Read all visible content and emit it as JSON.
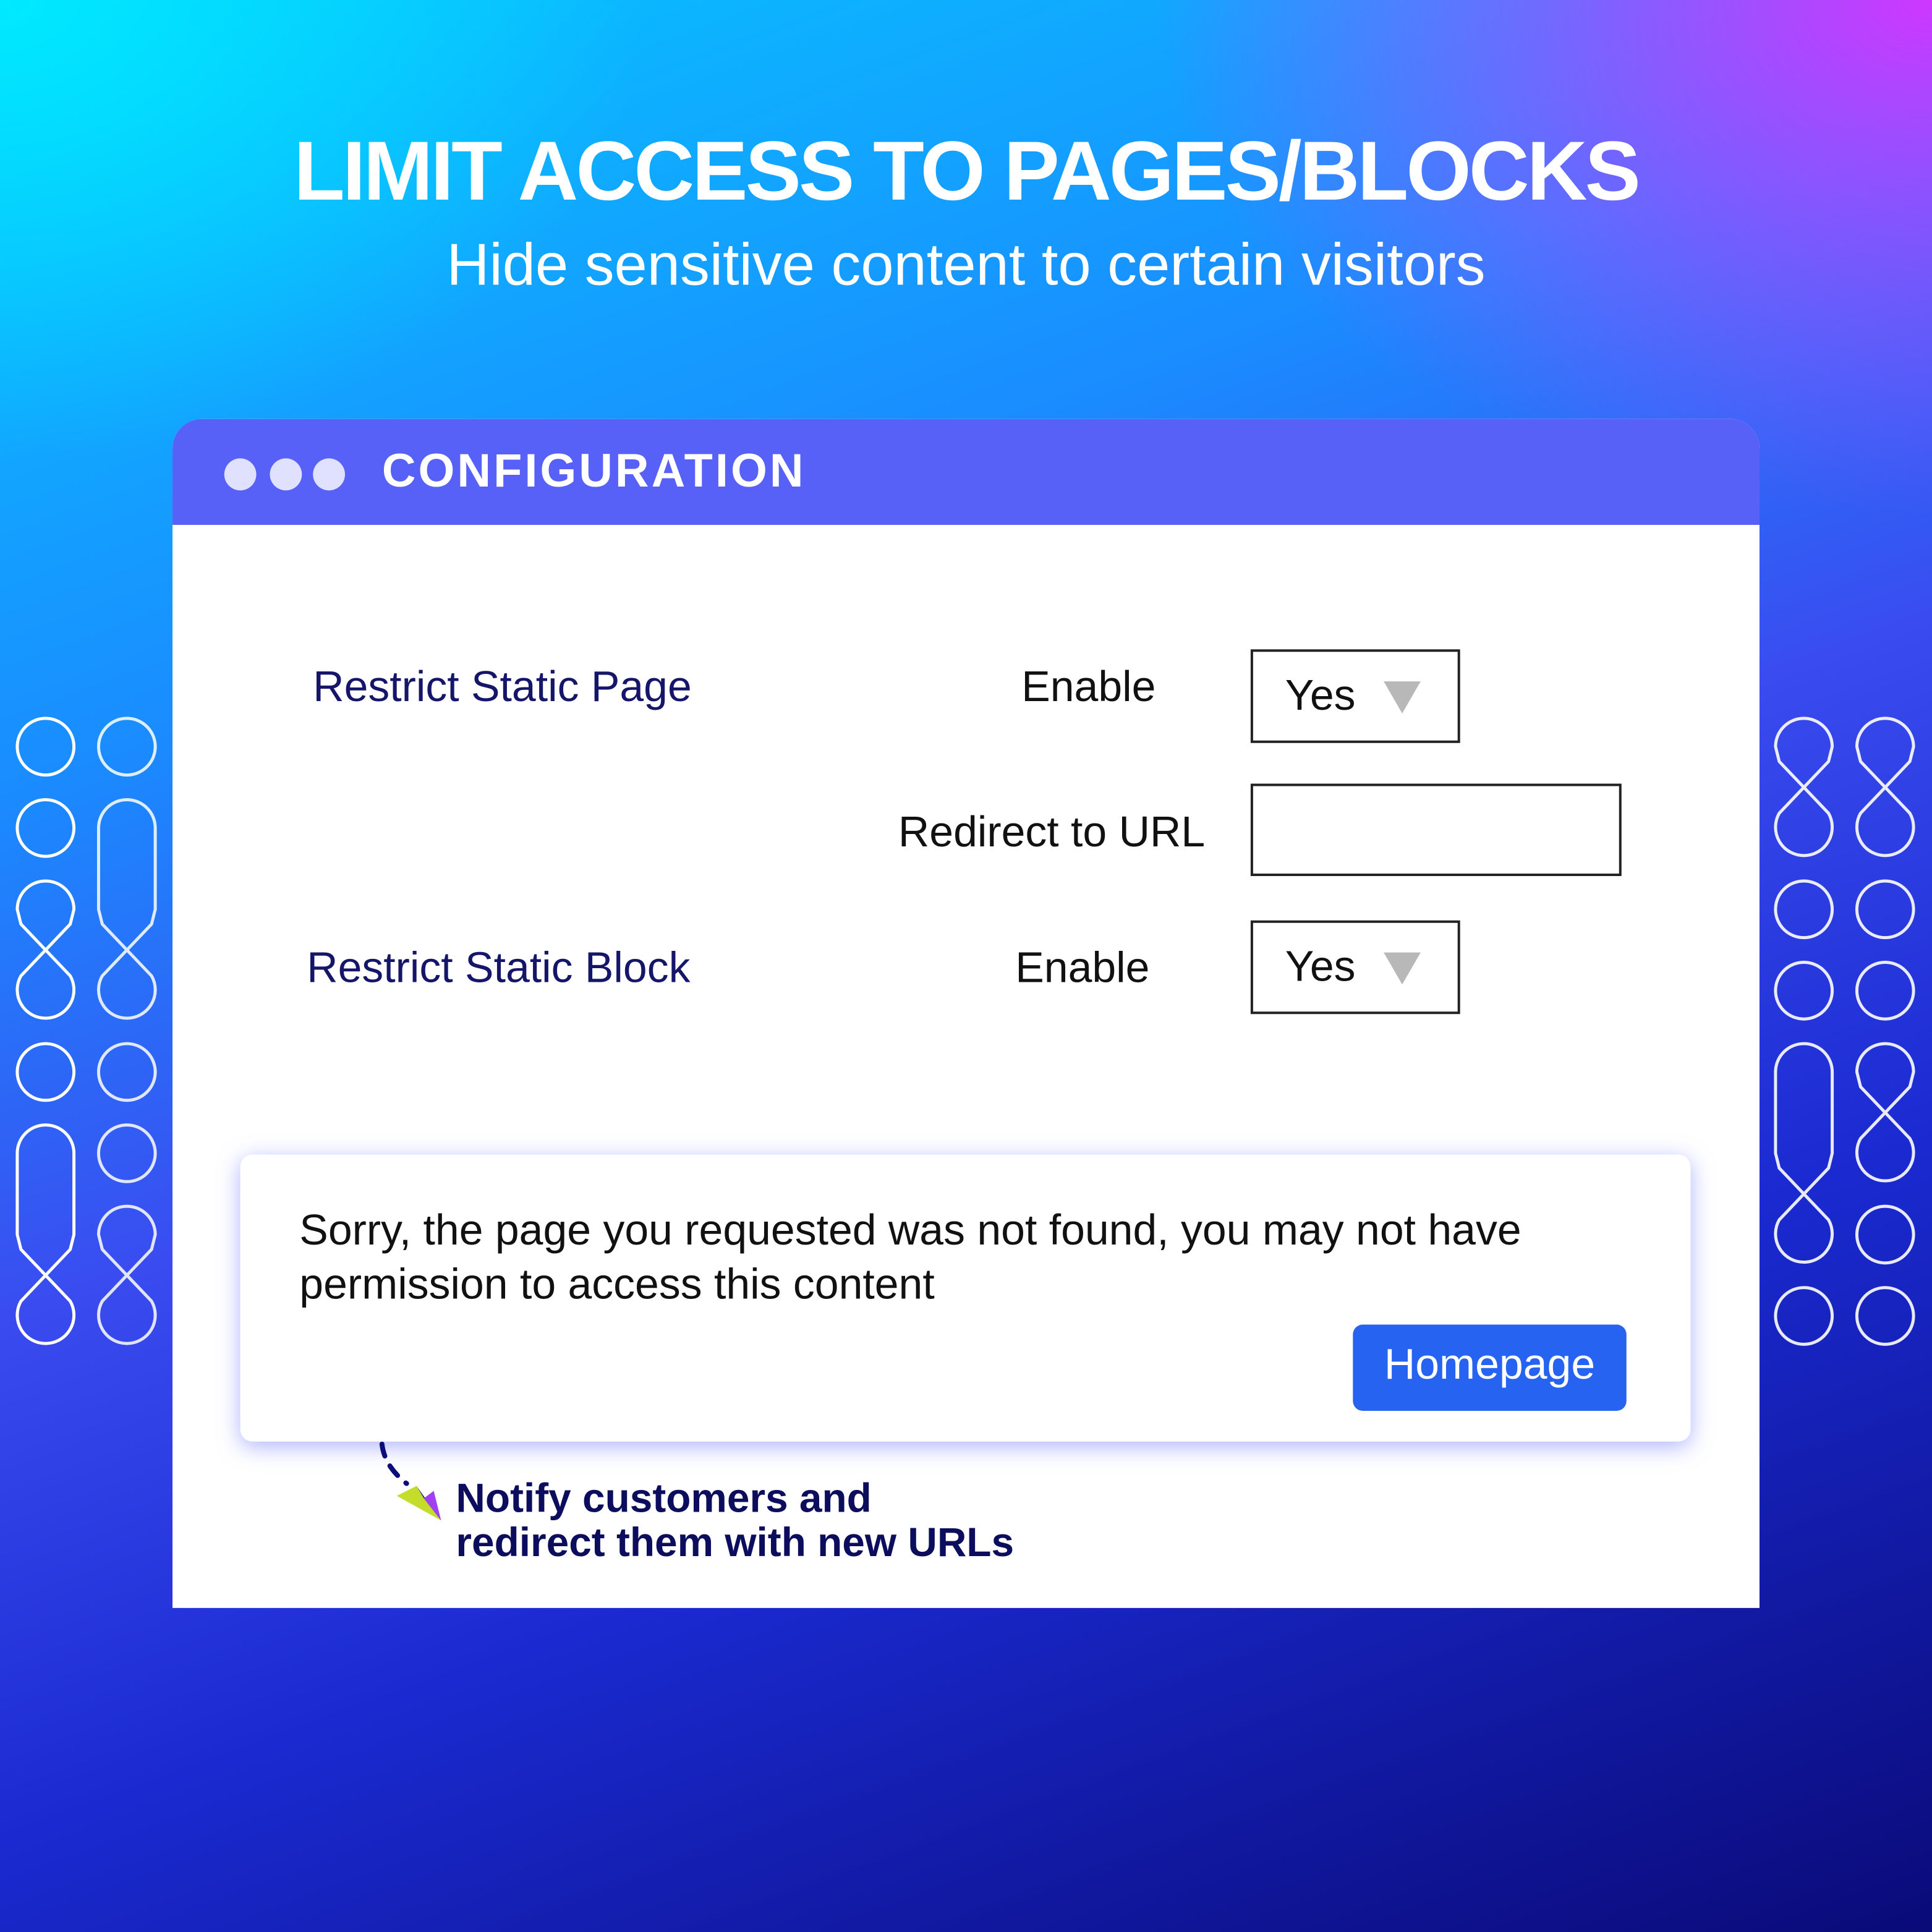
{
  "header": {
    "title": "LIMIT ACCESS TO PAGES/BLOCKS",
    "subtitle": "Hide sensitive content to certain visitors"
  },
  "window": {
    "title": "CONFIGURATION",
    "header_color": "#5761f7"
  },
  "config": {
    "rows": [
      {
        "section": "Restrict Static Page",
        "field": "Enable",
        "value": "Yes"
      },
      {
        "section": "",
        "field": "Redirect to URL",
        "value": ""
      },
      {
        "section": "Restrict Static Block",
        "field": "Enable",
        "value": "Yes"
      }
    ]
  },
  "message": {
    "text": "Sorry, the page you requested was not found, you may not have permission to access this content",
    "button_label": "Homepage",
    "button_color": "#2563f0"
  },
  "note": {
    "line1": "Notify customers and",
    "line2": "redirect them with new URLs",
    "icon": "arrow-pointer-icon"
  }
}
